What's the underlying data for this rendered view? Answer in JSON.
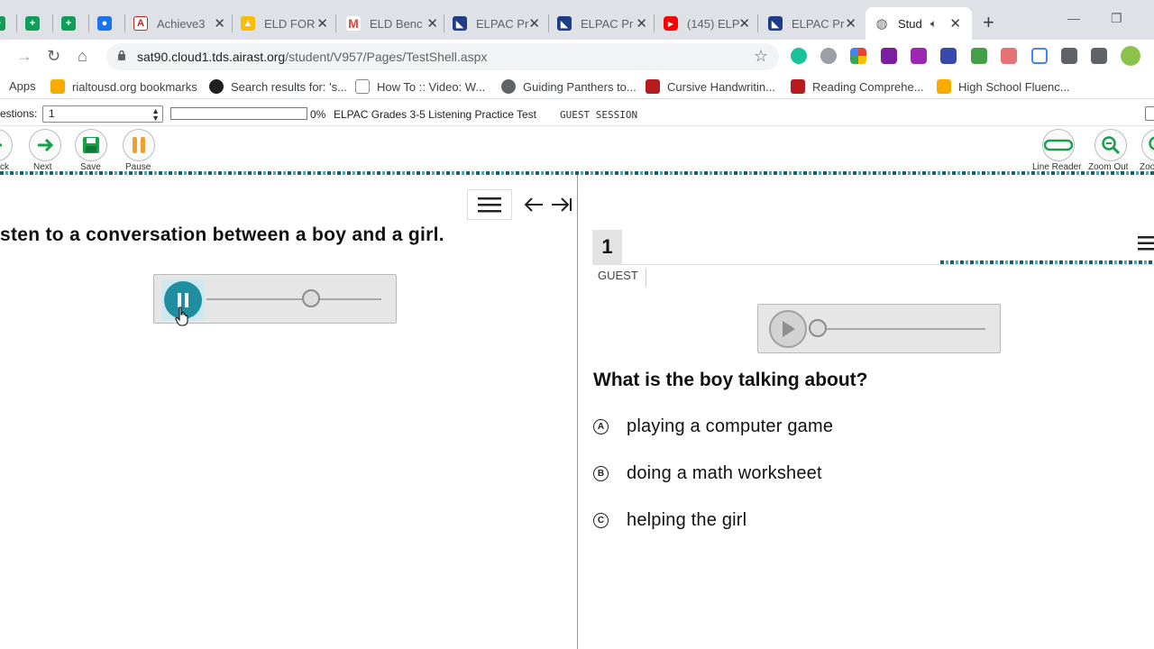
{
  "browser": {
    "tabs": [
      {
        "title": "",
        "color": "#0f9d58"
      },
      {
        "title": "",
        "color": "#0f9d58"
      },
      {
        "title": "",
        "color": "#1a73e8"
      },
      {
        "title": "Achieve3",
        "color": "#c5221f"
      },
      {
        "title": "ELD FOR",
        "color": "#fbbc04"
      },
      {
        "title": "ELD Benc",
        "color": "#ea4335"
      },
      {
        "title": "ELPAC Pr",
        "color": "#1f3c88"
      },
      {
        "title": "ELPAC Pr",
        "color": "#1f3c88"
      },
      {
        "title": "(145) ELP",
        "color": "#ff0000"
      },
      {
        "title": "ELPAC Pr",
        "color": "#1f3c88"
      },
      {
        "title": "Stud",
        "color": "#5f6368"
      }
    ],
    "url_host": "sat90.cloud1.tds.airast.org",
    "url_path": "/student/V957/Pages/TestShell.aspx",
    "bookmarks": [
      "Apps",
      "rialtousd.org bookmarks",
      "Search results for: 's...",
      "How To :: Video: W...",
      "Guiding Panthers to...",
      "Cursive Handwritin...",
      "Reading Comprehe...",
      "High School Fluenc..."
    ]
  },
  "shell": {
    "questions_label": "estions:",
    "question_value": "1",
    "progress_pct": 0,
    "progress_text": "0%",
    "test_name": "ELPAC Grades 3-5 Listening Practice Test",
    "session": "GUEST SESSION"
  },
  "toolbar": {
    "back": "ck",
    "next": "Next",
    "save": "Save",
    "pause": "Pause",
    "line_reader": "Line Reader",
    "zoom_out": "Zoom Out",
    "zoom_in": "Zoo"
  },
  "stimulus": {
    "instruction": "sten to a conversation between a boy and a girl.",
    "audio_state": "playing",
    "audio_position": 0.6
  },
  "item": {
    "number": "1",
    "user_label": "GUEST",
    "question": "What is the boy talking about?",
    "audio_position": 0.0,
    "options": [
      {
        "letter": "A",
        "text": "playing a computer game"
      },
      {
        "letter": "B",
        "text": "doing a math worksheet"
      },
      {
        "letter": "C",
        "text": "helping the girl"
      }
    ]
  },
  "colors": {
    "teal": "#1e8ea0",
    "next_green": "#17a04a",
    "pause_orange": "#f0a030"
  }
}
